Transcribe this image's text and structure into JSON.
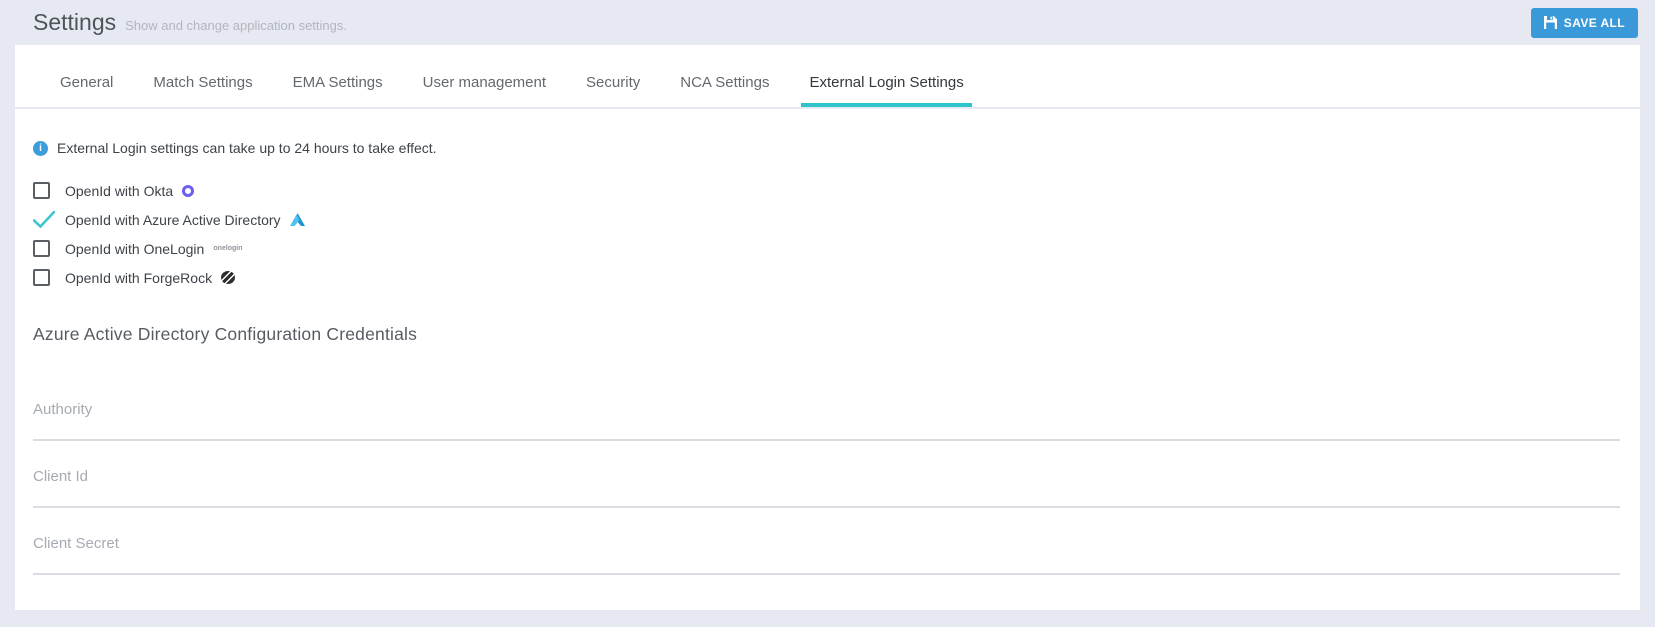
{
  "header": {
    "title": "Settings",
    "subtitle": "Show and change application settings.",
    "save_button": "SAVE ALL"
  },
  "tabs": [
    {
      "label": "General",
      "active": false
    },
    {
      "label": "Match Settings",
      "active": false
    },
    {
      "label": "EMA Settings",
      "active": false
    },
    {
      "label": "User management",
      "active": false
    },
    {
      "label": "Security",
      "active": false
    },
    {
      "label": "NCA Settings",
      "active": false
    },
    {
      "label": "External Login Settings",
      "active": true
    }
  ],
  "info_notice": "External Login settings can take up to 24 hours to take effect.",
  "providers": [
    {
      "label": "OpenId with Okta",
      "icon": "okta-icon",
      "checked": false
    },
    {
      "label": "OpenId with Azure Active Directory",
      "icon": "azure-icon",
      "checked": true
    },
    {
      "label": "OpenId with OneLogin",
      "icon": "onelogin-icon",
      "checked": false
    },
    {
      "label": "OpenId with ForgeRock",
      "icon": "forgerock-icon",
      "checked": false
    }
  ],
  "credentials_section": {
    "heading": "Azure Active Directory Configuration Credentials",
    "fields": [
      {
        "placeholder": "Authority",
        "value": ""
      },
      {
        "placeholder": "Client Id",
        "value": ""
      },
      {
        "placeholder": "Client Secret",
        "value": ""
      }
    ]
  },
  "icons": {
    "save": "floppy-disk-icon",
    "info": "info-circle-icon",
    "checked_mark": "teal-checkmark-icon",
    "onelogin_wordmark": "onelogin"
  },
  "colors": {
    "accent_teal": "#2fc3cd",
    "save_button_blue": "#3a99d8",
    "info_blue": "#3b9ddb",
    "okta_purple": "#6b5ff2",
    "azure_blue": "#1f95d4",
    "page_background": "#e7e9f2"
  }
}
